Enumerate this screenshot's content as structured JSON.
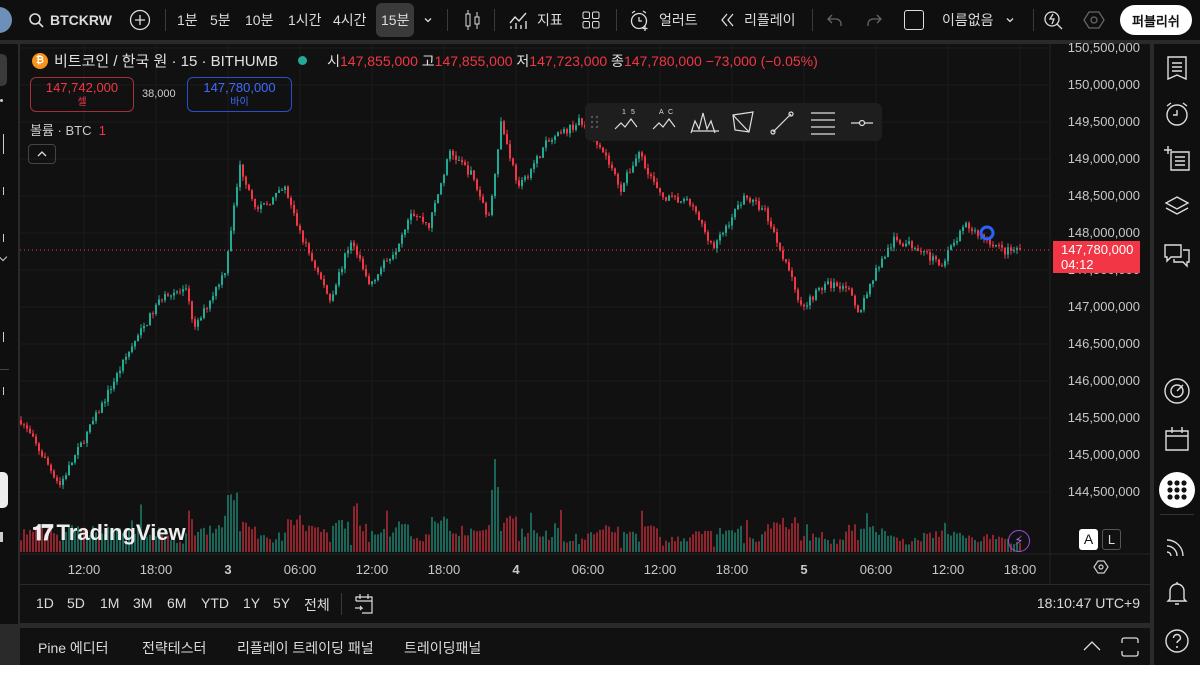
{
  "toolbar": {
    "symbol": "BTCKRW",
    "intervals": [
      "1분",
      "5분",
      "10분",
      "1시간",
      "4시간",
      "15분"
    ],
    "active_interval": "15분",
    "indicators_label": "지표",
    "alert_label": "얼러트",
    "replay_label": "리플레이",
    "layout_name": "이름없음",
    "publish_label": "퍼블리쉬"
  },
  "legend": {
    "title": "비트코인 / 한국 원 · 15 · BITHUMB",
    "open_label": "시",
    "open": "147,855,000",
    "high_label": "고",
    "high": "147,855,000",
    "low_label": "저",
    "low": "147,723,000",
    "close_label": "종",
    "close": "147,780,000",
    "change": "−73,000 (−0.05%)",
    "sell_price": "147,742,000",
    "sell_label": "셀",
    "spread": "38,000",
    "buy_price": "147,780,000",
    "buy_label": "바이",
    "volume_label": "볼륨 · BTC",
    "volume_value": "1"
  },
  "price_axis": {
    "ticks": [
      "150,500,000",
      "150,000,000",
      "149,500,000",
      "149,000,000",
      "148,500,000",
      "148,000,000",
      "147,500,000",
      "147,000,000",
      "146,500,000",
      "146,000,000",
      "145,500,000",
      "145,000,000",
      "144,500,000"
    ],
    "last_price": "147,780,000",
    "countdown": "04:12"
  },
  "time_axis": {
    "ticks": [
      "12:00",
      "18:00",
      "3",
      "06:00",
      "12:00",
      "18:00",
      "4",
      "06:00",
      "12:00",
      "18:00",
      "5",
      "06:00",
      "12:00",
      "18:00"
    ]
  },
  "watermark": "TradingView",
  "scale_buttons": {
    "auto": "A",
    "log": "L"
  },
  "range": {
    "buttons": [
      "1D",
      "5D",
      "1M",
      "3M",
      "6M",
      "YTD",
      "1Y",
      "5Y",
      "전체"
    ],
    "clock": "18:10:47 UTC+9"
  },
  "bottom_panel": {
    "tabs": [
      "Pine 에디터",
      "전략테스터",
      "리플레이 트레이딩 패널",
      "트레이딩패널"
    ]
  },
  "colors": {
    "up": "#22ab94",
    "down": "#f23645",
    "buy": "#2962ff",
    "background": "#111111"
  },
  "chart_data": {
    "type": "candlestick",
    "interval": "15",
    "yaxis_range": [
      144500000,
      150500000
    ],
    "approx_close_path": [
      [
        "2 06:45",
        145470000
      ],
      [
        "2 10:00",
        144600000
      ],
      [
        "2 13:15",
        145600000
      ],
      [
        "2 15:45",
        146400000
      ],
      [
        "2 18:45",
        147200000
      ],
      [
        "2 20:30",
        147200000
      ],
      [
        "2 21:15",
        146700000
      ],
      [
        "2 23:45",
        147500000
      ],
      [
        "3 01:00",
        148900000
      ],
      [
        "3 02:30",
        148300000
      ],
      [
        "3 04:45",
        148600000
      ],
      [
        "3 06:00",
        148000000
      ],
      [
        "3 08:30",
        147100000
      ],
      [
        "3 10:15",
        147900000
      ],
      [
        "3 11:45",
        147300000
      ],
      [
        "3 14:00",
        147800000
      ],
      [
        "3 15:15",
        148300000
      ],
      [
        "3 16:45",
        148100000
      ],
      [
        "3 18:30",
        149100000
      ],
      [
        "3 20:15",
        148800000
      ],
      [
        "3 21:45",
        148200000
      ],
      [
        "3 22:45",
        149500000
      ],
      [
        "4 00:15",
        148600000
      ],
      [
        "4 02:30",
        149200000
      ],
      [
        "4 05:15",
        149500000
      ],
      [
        "4 07:00",
        149200000
      ],
      [
        "4 08:45",
        148600000
      ],
      [
        "4 10:15",
        149100000
      ],
      [
        "4 12:00",
        148500000
      ],
      [
        "4 14:30",
        148400000
      ],
      [
        "4 16:30",
        147800000
      ],
      [
        "4 19:00",
        148500000
      ],
      [
        "4 20:45",
        148300000
      ],
      [
        "4 22:45",
        147500000
      ],
      [
        "4 23:45",
        147000000
      ],
      [
        "5 01:45",
        147300000
      ],
      [
        "5 03:30",
        147300000
      ],
      [
        "5 04:30",
        146900000
      ],
      [
        "5 06:00",
        147500000
      ],
      [
        "5 07:30",
        147900000
      ],
      [
        "5 09:45",
        147800000
      ],
      [
        "5 11:15",
        147550000
      ],
      [
        "5 13:30",
        148100000
      ],
      [
        "5 16:45",
        147750000
      ],
      [
        "5 18:00",
        147780000
      ]
    ]
  }
}
